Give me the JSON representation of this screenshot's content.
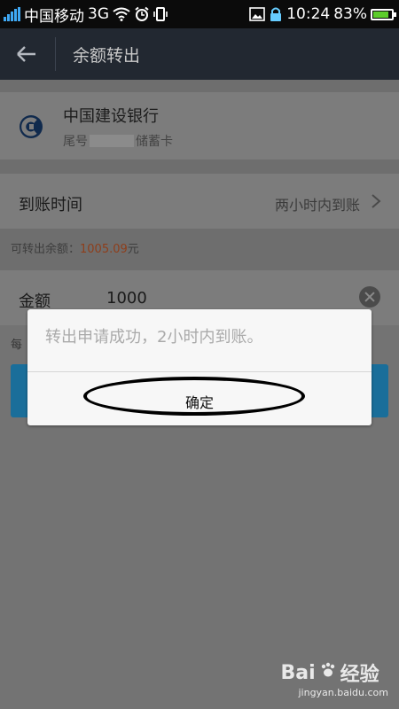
{
  "status_bar": {
    "carrier": "中国移动",
    "network": "3G",
    "time": "10:24",
    "battery": "83%",
    "battery_level": 0.83,
    "icons": [
      "signal-icon",
      "wifi-icon",
      "alarm-icon",
      "vibrate-icon",
      "image-icon",
      "lock-icon",
      "battery-icon"
    ]
  },
  "app_bar": {
    "title": "余额转出",
    "back_icon": "back-arrow-icon"
  },
  "bank": {
    "name": "中国建设银行",
    "tail_prefix": "尾号",
    "tail_suffix": "储蓄卡",
    "logo": "ccb-logo-icon"
  },
  "arrival": {
    "label": "到账时间",
    "value": "两小时内到账"
  },
  "available": {
    "label": "可转出余额：",
    "amount": "1005.09",
    "unit": "元"
  },
  "amount_field": {
    "label": "金额",
    "value": "1000"
  },
  "tip_peek": "每",
  "dialog": {
    "message": "转出申请成功，2小时内到账。",
    "ok_label": "确定"
  },
  "watermark": {
    "brand": "Bai",
    "brand_suffix": "经验",
    "url": "jingyan.baidu.com"
  },
  "colors": {
    "statusbar_bg": "#0b0b0b",
    "appbar_bg": "#222831",
    "overlay_bg": "#737373",
    "dialog_bg": "#f7f7f7",
    "accent_blue": "#1a6e9a",
    "amount_highlight": "#8e3e1b",
    "battery_green": "#5ccc2a"
  }
}
